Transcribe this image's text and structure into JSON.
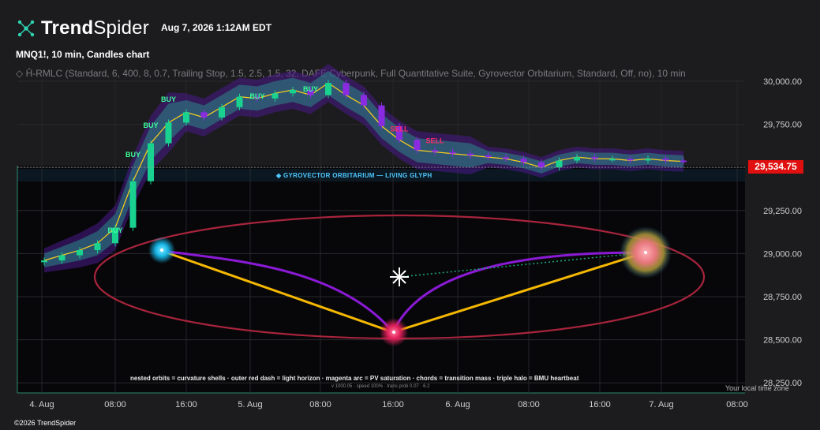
{
  "header": {
    "brand_bold": "Trend",
    "brand_thin": "Spider",
    "timestamp": "Aug 7, 2026 1:12AM EDT",
    "symbol": "MNQ1!, 10 min, Candles chart",
    "indicator": "◇ Ĥ-RMLC (Standard, 6, 400, 8, 0.7, Trailing Stop, 1.5, 2.5, 1.5, 32, DAFE Cyberpunk, Full Quantitative Suite, Gyrovector Orbitarium, Standard, Off, no), 10 min"
  },
  "price_tag": "29,534.75",
  "overlay": {
    "banner": "◆ GYROVECTOR ORBITARIUM — LIVING GLYPH",
    "legend": "nested orbits = curvature shells · outer red dash = light horizon · magenta arc = PV saturation · chords = transition mass · triple halo = BMU heartbeat",
    "legend_sub": "v 1000.05 · speed 100% · trans prob 0.07 · 6.2",
    "timezone": "Your local time zone"
  },
  "footer": "©2026 TrendSpider",
  "colors": {
    "up": "#19d28f",
    "down": "#8a2be2",
    "signal_buy": "#3cff9a",
    "signal_sell": "#ff2a6a",
    "gold": "#f5b800",
    "horizon": "#a8243c",
    "tag": "#e01010"
  },
  "chart_data": {
    "type": "candlestick",
    "title": "MNQ1!, 10 min, Candles chart",
    "ylim": [
      28250,
      30100
    ],
    "y_ticks": [
      "30,000.00",
      "29,750.00",
      "29,500.00",
      "29,250.00",
      "29,000.00",
      "28,750.00",
      "28,500.00",
      "28,250.00"
    ],
    "y_values": [
      30000,
      29750,
      29500,
      29250,
      29000,
      28750,
      28500,
      28250
    ],
    "x_ticks": [
      "4. Aug",
      "08:00",
      "16:00",
      "5. Aug",
      "08:00",
      "16:00",
      "6. Aug",
      "08:00",
      "16:00",
      "7. Aug",
      "08:00"
    ],
    "last_price": 29534.75,
    "series": [
      {
        "name": "MNQ1!",
        "x": [
          "4 Aug 00:00",
          "4 Aug 02:00",
          "4 Aug 04:00",
          "4 Aug 06:00",
          "4 Aug 08:00",
          "4 Aug 10:00",
          "4 Aug 12:00",
          "4 Aug 14:00",
          "4 Aug 16:00",
          "4 Aug 18:00",
          "4 Aug 20:00",
          "4 Aug 22:00",
          "5 Aug 00:00",
          "5 Aug 02:00",
          "5 Aug 04:00",
          "5 Aug 06:00",
          "5 Aug 08:00",
          "5 Aug 10:00",
          "5 Aug 12:00",
          "5 Aug 14:00",
          "5 Aug 16:00",
          "5 Aug 18:00",
          "5 Aug 20:00",
          "5 Aug 22:00",
          "6 Aug 00:00",
          "6 Aug 02:00",
          "6 Aug 04:00",
          "6 Aug 06:00",
          "6 Aug 08:00",
          "6 Aug 10:00",
          "6 Aug 12:00",
          "6 Aug 14:00",
          "6 Aug 16:00",
          "6 Aug 18:00",
          "6 Aug 20:00",
          "6 Aug 22:00",
          "7 Aug 00:00"
        ],
        "values": [
          28960,
          28990,
          29020,
          29060,
          29150,
          29420,
          29640,
          29760,
          29820,
          29790,
          29850,
          29910,
          29900,
          29930,
          29950,
          29920,
          29990,
          29920,
          29860,
          29740,
          29660,
          29600,
          29590,
          29580,
          29570,
          29560,
          29550,
          29530,
          29500,
          29540,
          29560,
          29550,
          29550,
          29540,
          29550,
          29540,
          29535
        ]
      }
    ],
    "signals": [
      {
        "label": "BUY",
        "x": "4 Aug 08:00",
        "y": 29120
      },
      {
        "label": "BUY",
        "x": "4 Aug 10:00",
        "y": 29560
      },
      {
        "label": "BUY",
        "x": "4 Aug 12:00",
        "y": 29730
      },
      {
        "label": "BUY",
        "x": "4 Aug 14:00",
        "y": 29880
      },
      {
        "label": "BUY",
        "x": "5 Aug 00:00",
        "y": 29900
      },
      {
        "label": "BUY",
        "x": "5 Aug 06:00",
        "y": 29940
      },
      {
        "label": "SELL",
        "x": "5 Aug 16:00",
        "y": 29710
      },
      {
        "label": "SELL",
        "x": "5 Aug 20:00",
        "y": 29640
      }
    ]
  }
}
